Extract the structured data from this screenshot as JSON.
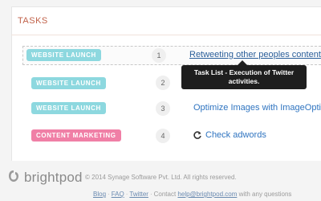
{
  "section": {
    "title": "TASKS"
  },
  "tasks": [
    {
      "label": "WEBSITE LAUNCH",
      "number": "1",
      "name": "Retweeting other peoples content",
      "badge_color": "#8dd8df"
    },
    {
      "label": "WEBSITE LAUNCH",
      "number": "2",
      "name": "",
      "badge_color": "#8dd8df"
    },
    {
      "label": "WEBSITE LAUNCH",
      "number": "3",
      "name": "Optimize Images with ImageOptim",
      "badge_color": "#8dd8df"
    },
    {
      "label": "CONTENT MARKETING",
      "number": "4",
      "name": "Check adwords",
      "badge_color": "#f07fa6"
    }
  ],
  "tooltip": {
    "line1": "Task List - Execution of Twitter",
    "line2": "activities."
  },
  "footer": {
    "brand": "brightpod",
    "copyright": "© 2014 Synage Software Pvt. Ltd. All rights reserved.",
    "links": [
      "Blog",
      "FAQ",
      "Twitter"
    ],
    "contact_prefix": "Contact",
    "contact_email": "help@brightpod.com",
    "contact_suffix": "with any questions"
  },
  "colors": {
    "accent_title": "#c1624a",
    "link": "#2f74c0",
    "tooltip_bg": "#1e1e1e"
  }
}
